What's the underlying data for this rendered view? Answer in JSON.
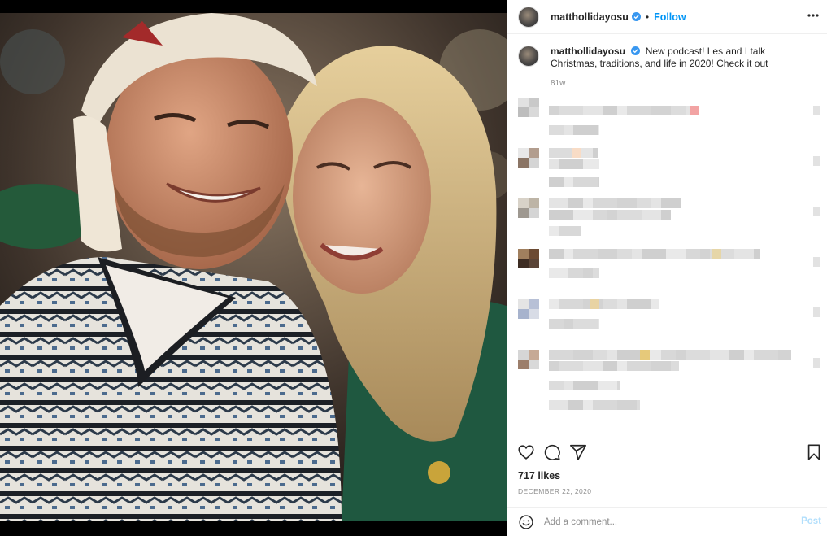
{
  "post": {
    "username": "mattholliday",
    "username_suffix": "osu",
    "follow_label": "Follow",
    "dot": "•",
    "caption": {
      "username": "mattholliday",
      "username_suffix": "osu",
      "text": "New podcast! Les and I talk Christmas, traditions, and life in 2020! Check it out",
      "time": "81w"
    },
    "likes": "717 likes",
    "date": "DECEMBER 22, 2020",
    "comment_placeholder": "Add a comment...",
    "post_label": "Post"
  },
  "colors": {
    "accent": "#0095f6",
    "post_disabled": "#b2dffc",
    "muted": "#8e8e8e",
    "verified": "#3897f0"
  },
  "icons": {
    "more": "more-horizontal-icon",
    "like": "heart-icon",
    "comment": "comment-icon",
    "share": "paper-plane-icon",
    "save": "bookmark-icon",
    "emoji": "emoji-smile-icon",
    "verified": "verified-badge-icon"
  },
  "comments_pixelated": true
}
